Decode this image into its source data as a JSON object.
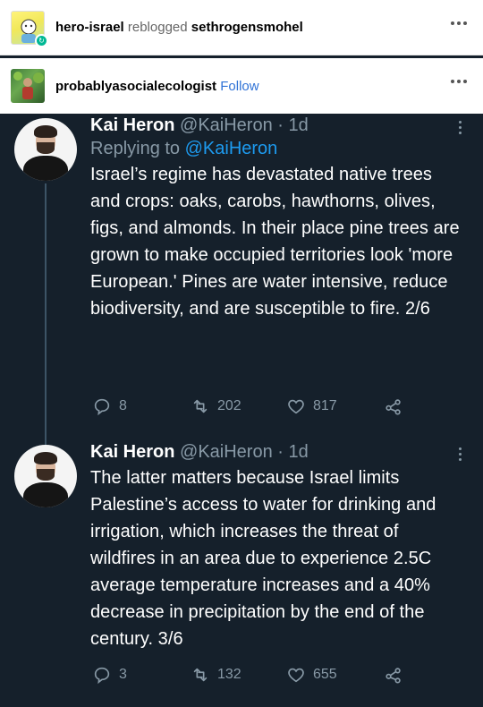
{
  "reblog": {
    "blog_name": "hero-israel",
    "action_text": "reblogged",
    "source_name": "sethrogensmohel"
  },
  "post": {
    "author": "probablyasocialecologist",
    "follow_label": "Follow"
  },
  "tweets": [
    {
      "name": "Kai Heron",
      "handle": "@KaiHeron",
      "time": "· 1d",
      "replying_prefix": "Replying to",
      "replying_to": "@KaiHeron",
      "text": "Israel’s regime has devastated native trees and crops: oaks, carobs, hawthorns, olives, figs, and almonds. In their place pine trees are grown to make occupied territories look 'more European.' Pines are water intensive, reduce biodiversity, and are susceptible to fire. 2/6",
      "replies": "8",
      "retweets": "202",
      "likes": "817"
    },
    {
      "name": "Kai Heron",
      "handle": "@KaiHeron",
      "time": "· 1d",
      "text": "The latter matters because Israel limits Palestine’s access to water for drinking and irrigation, which increases the threat of wildfires in an area due to experience 2.5C average temperature increases and a 40% decrease in precipitation by the end of the century. 3/6",
      "replies": "3",
      "retweets": "132",
      "likes": "655"
    }
  ],
  "icons": {
    "reply": "reply-icon",
    "retweet": "retweet-icon",
    "like": "heart-icon",
    "share": "share-icon",
    "more": "more-options-icon"
  },
  "colors": {
    "tweet_bg": "#15202b",
    "link_blue": "#1d9bf0",
    "follow_blue": "#2f72d6",
    "muted": "#8899a6"
  }
}
